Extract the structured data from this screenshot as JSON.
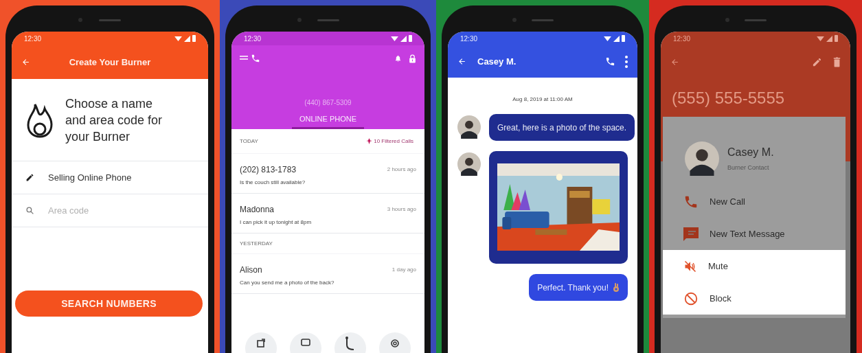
{
  "screens": [
    {
      "kind": "create",
      "status_time": "12:30",
      "title": "Create Your Burner",
      "heading": "Choose a name and area code for your Burner",
      "fields": [
        {
          "kind": "name",
          "value": "Selling Online Phone"
        },
        {
          "kind": "search",
          "placeholder": "Area code"
        }
      ],
      "button": "SEARCH NUMBERS"
    },
    {
      "kind": "inbox",
      "status_time": "12:30",
      "phone_number": "(440) 867-5309",
      "tabs": [
        {
          "label": "ONLINE PHONE",
          "selected": true
        }
      ],
      "sections": [
        {
          "label": "TODAY",
          "filter": "10 Filtered Calls",
          "items": [
            {
              "name": "(202) 813-1783",
              "message": "Is the couch still available?",
              "time": "2 hours ago"
            },
            {
              "name": "Madonna",
              "message": "I can pick it up tonight at 8pm",
              "time": "3 hours ago"
            }
          ]
        },
        {
          "label": "YESTERDAY",
          "items": [
            {
              "name": "Alison",
              "message": "Can you send me a photo of the back?",
              "time": "1 day ago"
            }
          ]
        }
      ]
    },
    {
      "kind": "chat",
      "status_time": "12:30",
      "title": "Casey M.",
      "date": "Aug 8, 2019 at 11:00 AM",
      "messages": [
        {
          "outgoing": false,
          "kind": "text",
          "text": "Great, here is a photo of the space."
        },
        {
          "outgoing": false,
          "kind": "picture"
        },
        {
          "outgoing": true,
          "kind": "text",
          "text": "Perfect. Thank you!",
          "trailing_icon": true
        }
      ]
    },
    {
      "kind": "contact",
      "status_time": "12:30",
      "phone_number": "(555) 555-5555",
      "contact": {
        "name": "Casey M.",
        "subtitle": "Burner Contact"
      },
      "actions": [
        {
          "kind": "call",
          "label": "New Call",
          "highlighted": false
        },
        {
          "kind": "text",
          "label": "New Text Message",
          "highlighted": false
        },
        {
          "kind": "mute",
          "label": "Mute",
          "highlighted": true
        },
        {
          "kind": "block",
          "label": "Block",
          "highlighted": true
        }
      ]
    }
  ]
}
